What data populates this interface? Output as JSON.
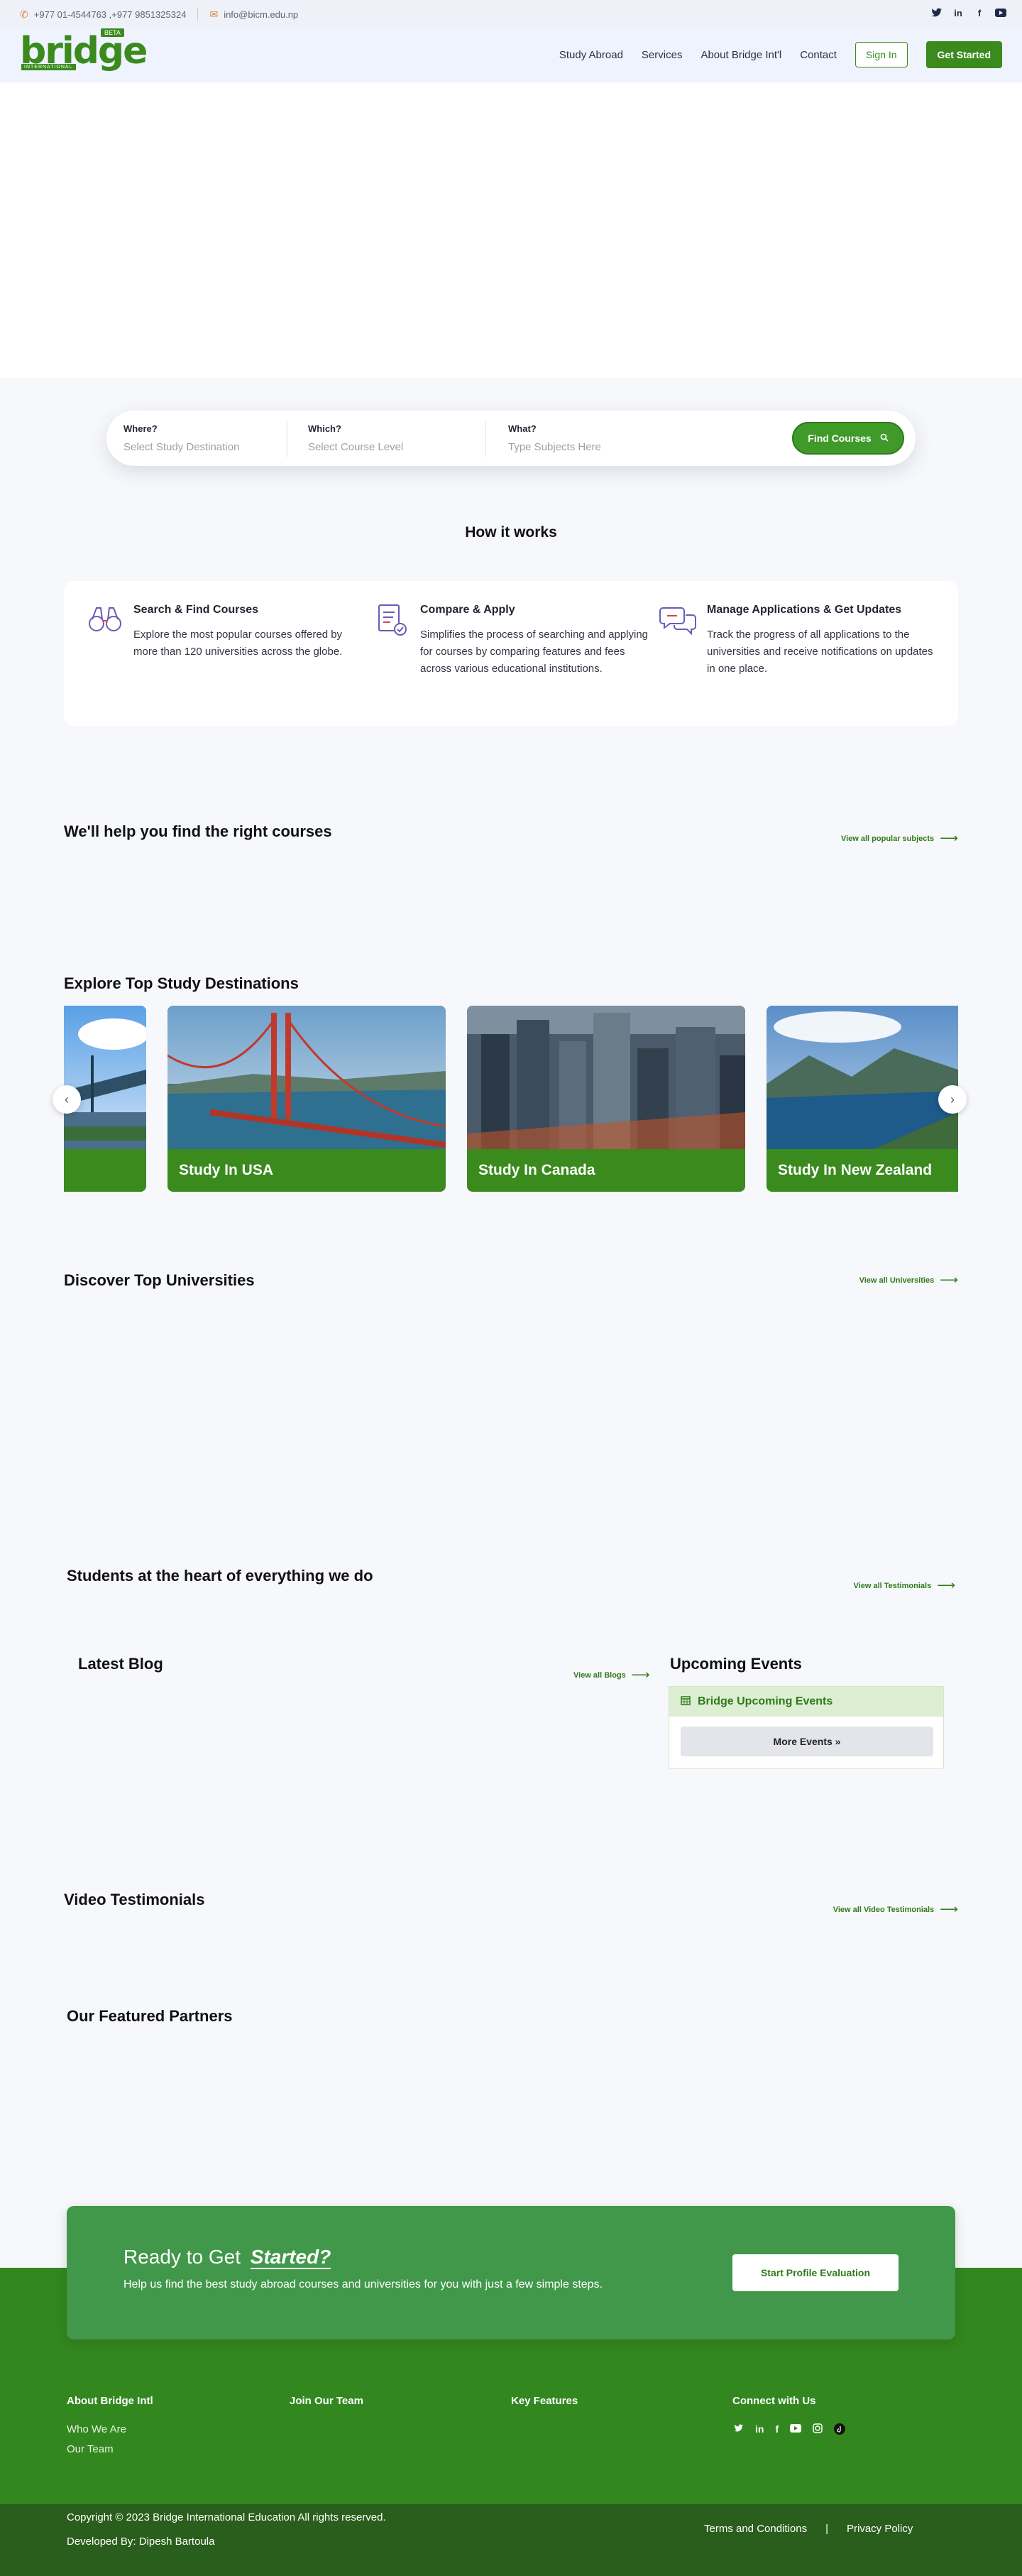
{
  "topbar": {
    "phone": "+977 01-4544763 ,+977 9851325324",
    "email": "info@bicm.edu.np",
    "social": [
      "twitter-icon",
      "linkedin-icon",
      "facebook-icon",
      "youtube-icon"
    ]
  },
  "header": {
    "logo_word": "bridge",
    "logo_beta": "BETA",
    "logo_sub": "INTERNATIONAL",
    "nav": [
      "Study Abroad",
      "Services",
      "About Bridge Int'l",
      "Contact"
    ],
    "sign_in": "Sign In",
    "get_started": "Get Started"
  },
  "search": {
    "where_label": "Where?",
    "where_placeholder": "Select Study Destination",
    "which_label": "Which?",
    "which_placeholder": "Select Course Level",
    "what_label": "What?",
    "what_placeholder": "Type Subjects Here",
    "button": "Find Courses"
  },
  "how": {
    "title": "How it works",
    "items": [
      {
        "title": "Search & Find Courses",
        "desc": "Explore the most popular courses offered by more than 120 universities across the globe."
      },
      {
        "title": "Compare & Apply",
        "desc": "Simplifies the process of searching and applying for courses by comparing features and fees across various educational institutions."
      },
      {
        "title": "Manage Applications & Get Updates",
        "desc": "Track the progress of all applications to the universities and receive notifications on updates in one place."
      }
    ]
  },
  "courses": {
    "title": "We'll help you find the right courses",
    "link": "View all popular subjects"
  },
  "destinations": {
    "title": "Explore Top Study Destinations",
    "cards": [
      "Study In USA",
      "Study In Canada",
      "Study In New Zealand"
    ]
  },
  "universities": {
    "title": "Discover Top Universities",
    "link": "View all Universities"
  },
  "students": {
    "title": "Students at the heart of everything we do",
    "link": "View all Testimonials"
  },
  "blog": {
    "title": "Latest Blog",
    "link": "View all Blogs"
  },
  "events": {
    "title": "Upcoming Events",
    "head": "Bridge Upcoming Events",
    "more": "More Events »"
  },
  "video": {
    "title": "Video Testimonials",
    "link": "View all Video Testimonials"
  },
  "partners": {
    "title": "Our Featured Partners"
  },
  "cta": {
    "line1_a": "Ready to Get",
    "line1_b": "Started?",
    "line2": "Help us find the best study abroad courses and universities for you with just a few simple steps.",
    "button": "Start Profile Evaluation"
  },
  "footer": {
    "about_title": "About Bridge Intl",
    "about_links": [
      "Who We Are",
      "Our Team"
    ],
    "join_title": "Join Our Team",
    "features_title": "Key Features",
    "connect_title": "Connect with Us",
    "copyright": "Copyright © 2023 Bridge International Education All rights reserved.",
    "developer": "Developed By: Dipesh Bartoula",
    "terms": "Terms and Conditions",
    "divider": "|",
    "privacy": "Privacy Policy"
  }
}
